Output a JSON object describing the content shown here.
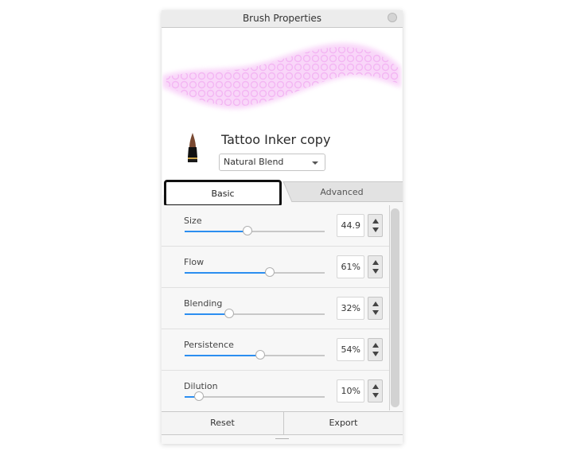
{
  "window": {
    "title": "Brush Properties",
    "close_icon": "circle-close-icon"
  },
  "preview": {
    "stroke_color": "#f6c6f6",
    "description": "brush stroke preview"
  },
  "brush": {
    "icon": "ink-pen-brush-icon",
    "name": "Tattoo Inker copy",
    "blend_mode": {
      "selected": "Natural Blend"
    }
  },
  "tabs": [
    {
      "label": "Basic",
      "active": true
    },
    {
      "label": "Advanced",
      "active": false
    }
  ],
  "settings": [
    {
      "label": "Size",
      "value_text": "44.9",
      "fraction": 0.449
    },
    {
      "label": "Flow",
      "value_text": "61%",
      "fraction": 0.61
    },
    {
      "label": "Blending",
      "value_text": "32%",
      "fraction": 0.32
    },
    {
      "label": "Persistence",
      "value_text": "54%",
      "fraction": 0.54
    },
    {
      "label": "Dilution",
      "value_text": "10%",
      "fraction": 0.1
    }
  ],
  "colors": {
    "slider_fill": "#2c8ef0",
    "slider_track": "#c8c8c8"
  },
  "footer": {
    "reset_label": "Reset",
    "export_label": "Export"
  }
}
